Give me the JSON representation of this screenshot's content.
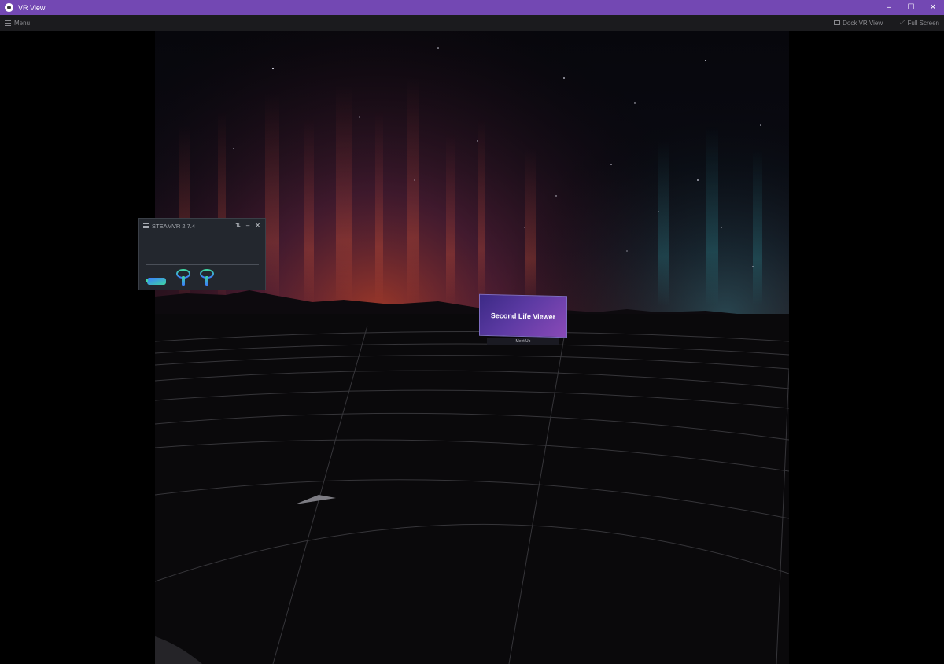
{
  "window": {
    "title": "VR View",
    "controls": {
      "minimize": "–",
      "maximize": "☐",
      "close": "✕"
    }
  },
  "toolbar": {
    "menu_label": "Menu",
    "dock_label": "Dock VR View",
    "fullscreen_label": "Full Screen"
  },
  "steamvr_panel": {
    "title": "STEAMVR 2.7.4",
    "devices": [
      "headset-icon",
      "controller-icon",
      "controller-icon"
    ]
  },
  "app_card": {
    "title": "Second Life Viewer",
    "tag": "Meet Up"
  },
  "colors": {
    "titlebar": "#7348b3",
    "toolbar": "#1b1b1e",
    "device_gradient_start": "#3b7cff",
    "device_gradient_end": "#3fd6a2"
  }
}
